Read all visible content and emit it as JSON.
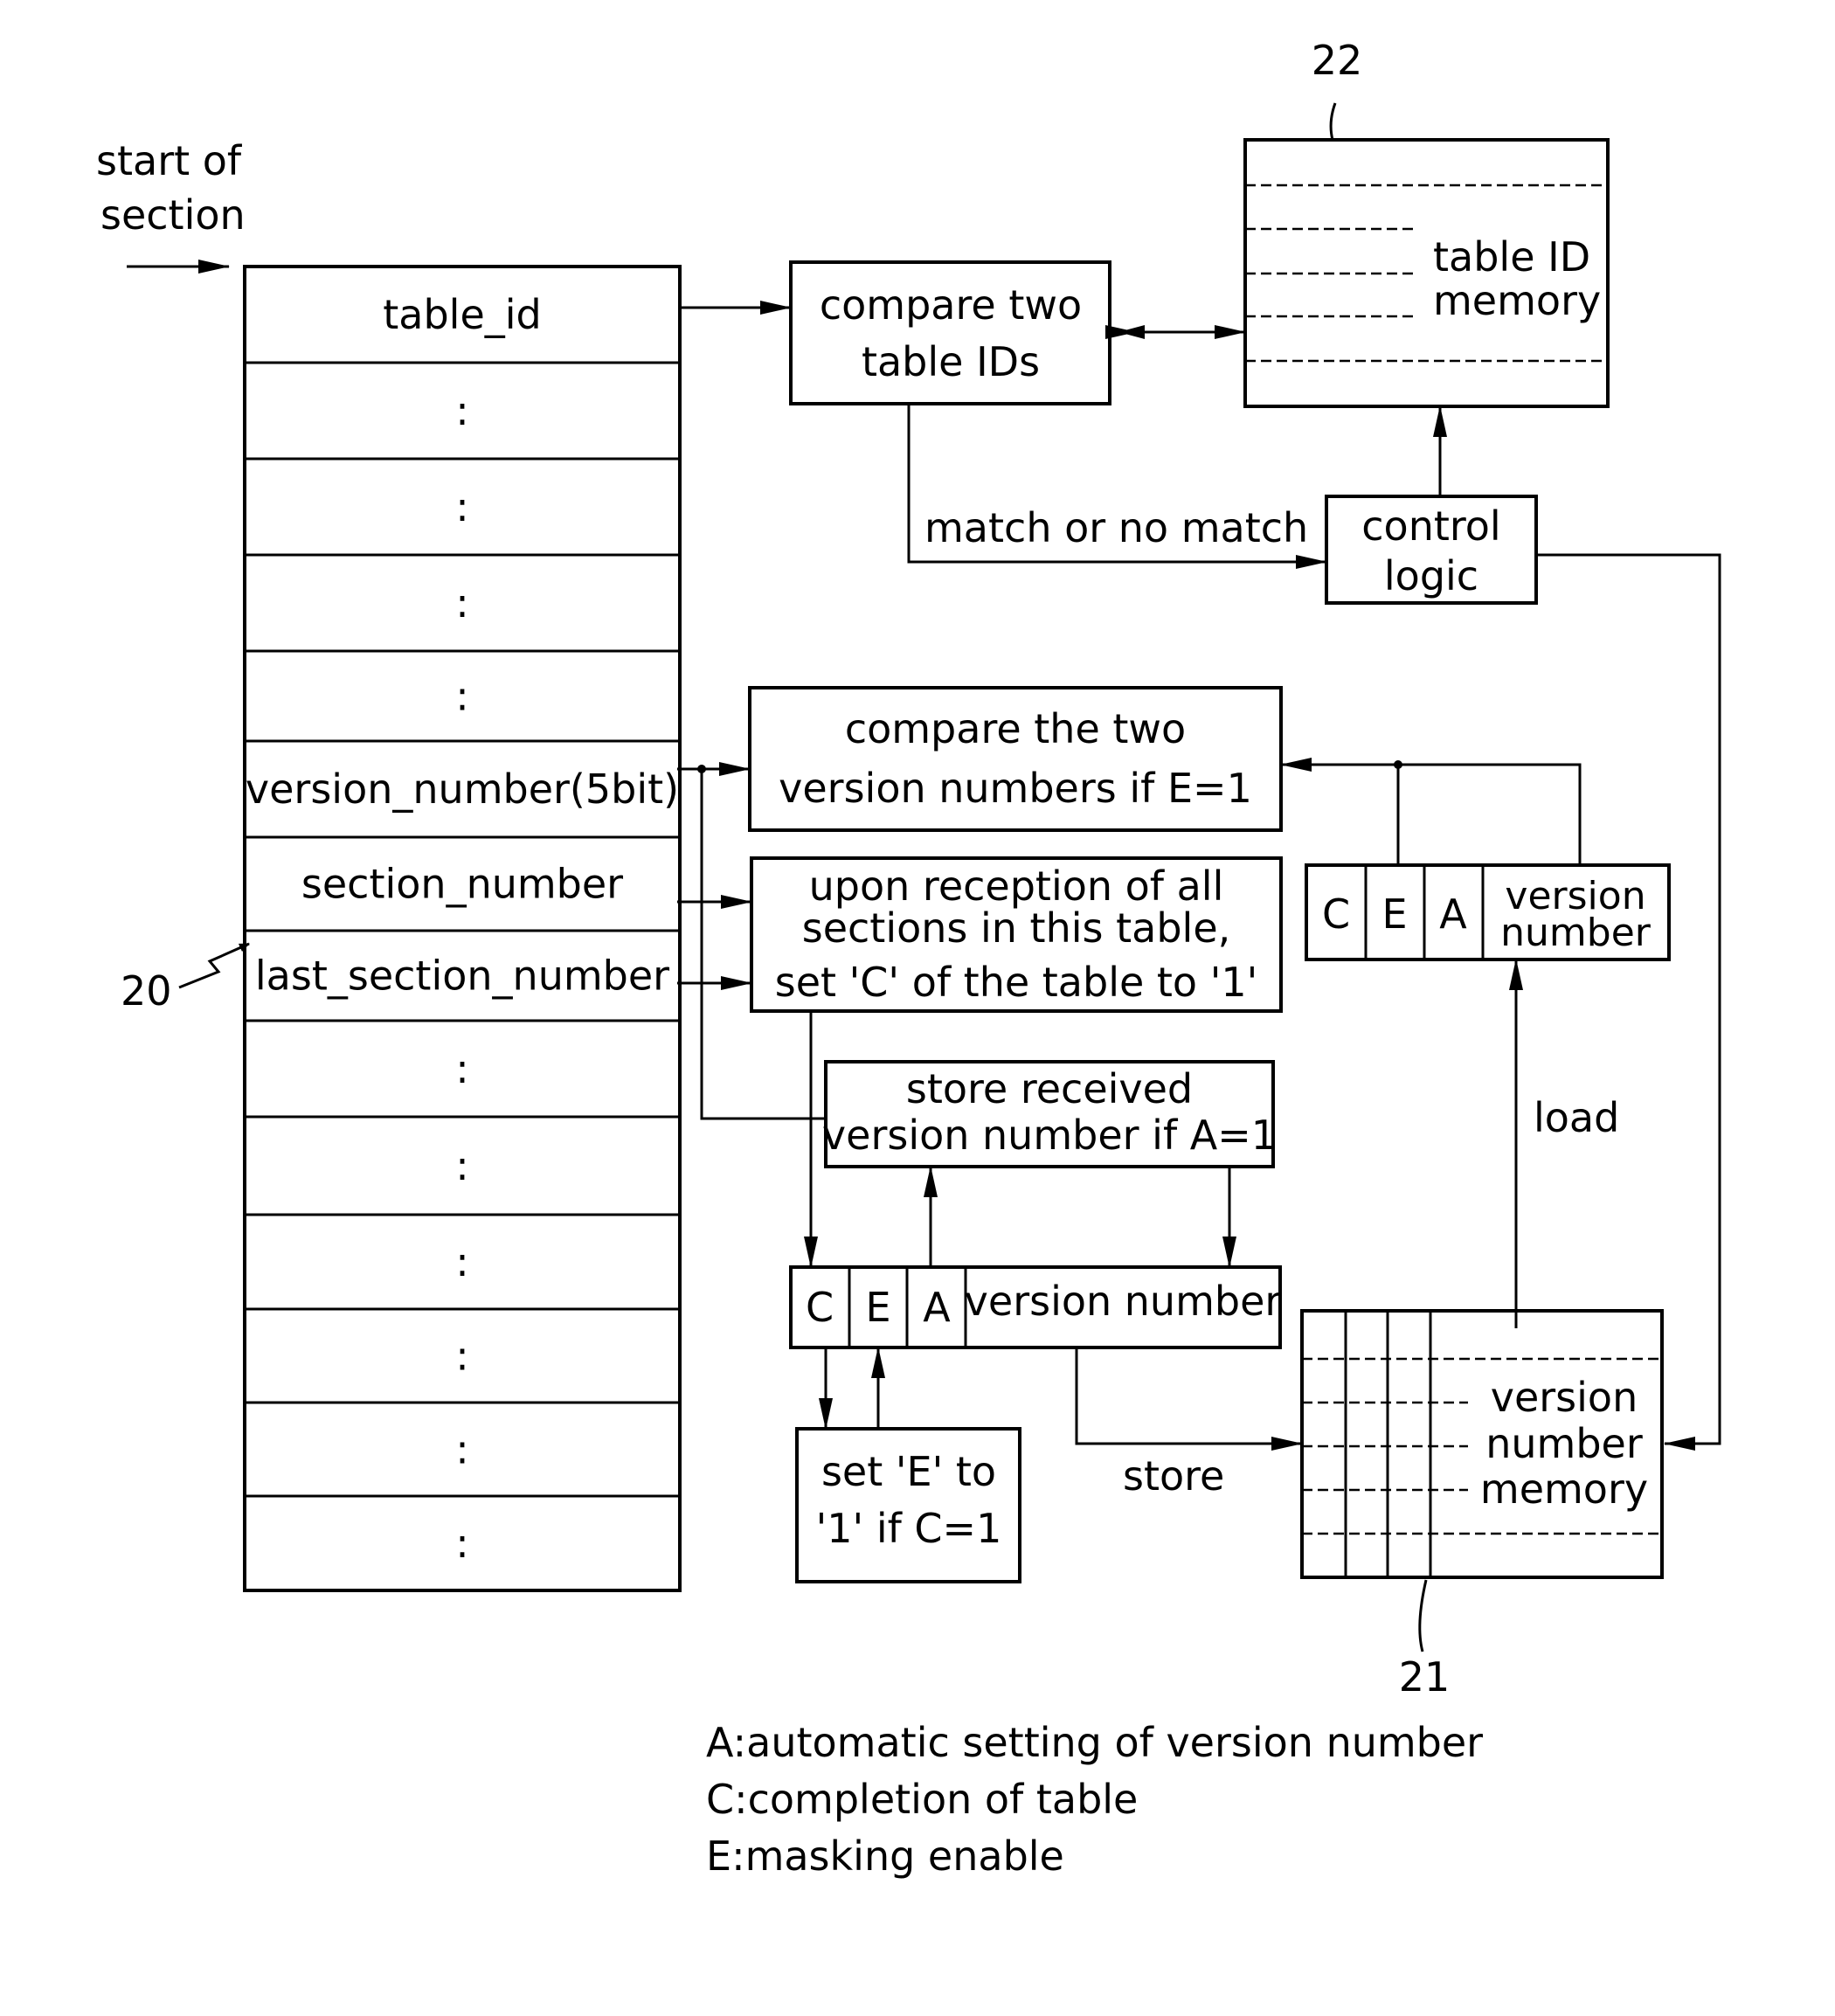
{
  "start_label": [
    "start of",
    "section"
  ],
  "section_fields": [
    "table_id",
    ":",
    ":",
    ":",
    ":",
    "version_number(5bit)",
    "section_number",
    "last_section_number",
    ":",
    ":",
    ":",
    ":",
    ":",
    ":"
  ],
  "ref_numbers": {
    "section": "20",
    "version_memory": "21",
    "table_id_memory": "22"
  },
  "boxes": {
    "compare_table_ids": [
      "compare two",
      "table IDs"
    ],
    "table_id_memory": [
      "table ID",
      "memory"
    ],
    "control_logic": [
      "control",
      "logic"
    ],
    "compare_versions": [
      "compare the two",
      "version numbers if E=1"
    ],
    "reception": [
      "upon reception of all",
      "sections in this table,",
      "set 'C' of the table to '1'"
    ],
    "store_received": [
      "store received",
      "version number if A=1"
    ],
    "set_e": [
      "set 'E' to",
      "'1' if C=1"
    ],
    "version_memory": [
      "version",
      "number",
      "memory"
    ]
  },
  "registers": {
    "upper": {
      "c": "C",
      "e": "E",
      "a": "A",
      "vn": [
        "version",
        "number"
      ]
    },
    "lower": {
      "c": "C",
      "e": "E",
      "a": "A",
      "vn": "version number"
    }
  },
  "edge_labels": {
    "match": "match or no match",
    "load": "load",
    "store": "store"
  },
  "legend": [
    "A:automatic setting of version number",
    "C:completion of table",
    "E:masking enable"
  ]
}
